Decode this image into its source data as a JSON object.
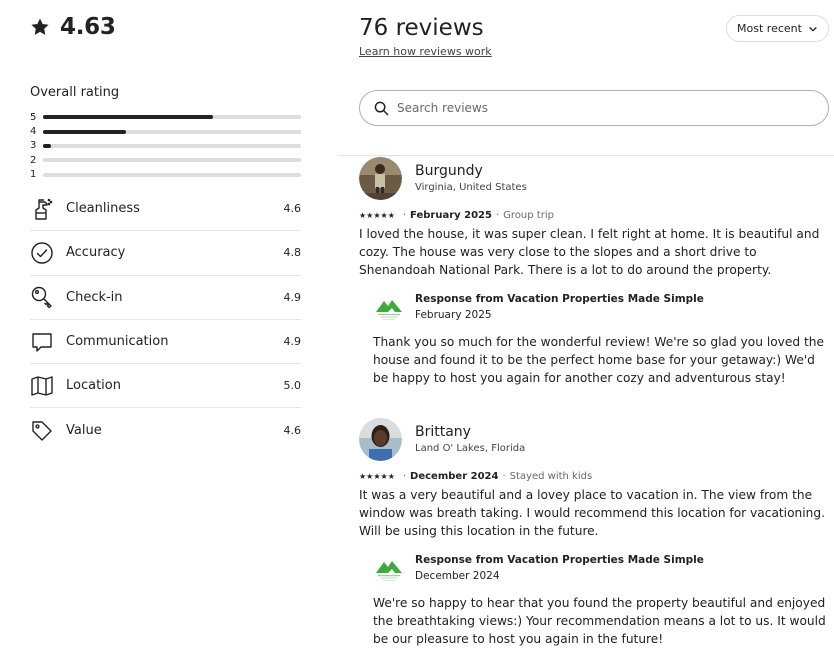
{
  "summary": {
    "average": "4.63"
  },
  "overall": {
    "title": "Overall rating",
    "bars": [
      {
        "label": "5",
        "fraction": 0.66
      },
      {
        "label": "4",
        "fraction": 0.32
      },
      {
        "label": "3",
        "fraction": 0.03
      },
      {
        "label": "2",
        "fraction": 0.0
      },
      {
        "label": "1",
        "fraction": 0.0
      }
    ]
  },
  "categories": [
    {
      "label": "Cleanliness",
      "value": "4.6",
      "icon": "spray-bottle-icon"
    },
    {
      "label": "Accuracy",
      "value": "4.8",
      "icon": "check-circle-icon"
    },
    {
      "label": "Check-in",
      "value": "4.9",
      "icon": "key-icon"
    },
    {
      "label": "Communication",
      "value": "4.9",
      "icon": "chat-bubble-icon"
    },
    {
      "label": "Location",
      "value": "5.0",
      "icon": "map-icon"
    },
    {
      "label": "Value",
      "value": "4.6",
      "icon": "price-tag-icon"
    }
  ],
  "reviews_header": {
    "title": "76 reviews",
    "learn_link": "Learn how reviews work",
    "sort_label": "Most recent"
  },
  "search": {
    "placeholder": "Search reviews"
  },
  "reviews": [
    {
      "name": "Burgundy",
      "location": "Virginia, United States",
      "stars": "★★★★★",
      "date": "February 2025",
      "trip": "Group trip",
      "text": "I loved the house, it was super clean. I felt right at home. It is beautiful and cozy. The house was very close to the slopes and a short drive to Shenandoah National Park. There is a lot to do around the property.",
      "response": {
        "title": "Response from Vacation Properties Made Simple",
        "date": "February 2025",
        "text": "Thank you so much for the wonderful review! We're so glad you loved the house and found it to be the perfect home base for your getaway:) We'd be happy to host you again for another cozy and adventurous stay!"
      }
    },
    {
      "name": "Brittany",
      "location": "Land O' Lakes, Florida",
      "stars": "★★★★★",
      "date": "December 2024",
      "trip": "Stayed with kids",
      "text": "It was a very beautiful and a lovey place to vacation in. The view from the window was breath taking. I would recommend this location for vacationing. Will be using this location in the future.",
      "response": {
        "title": "Response from Vacation Properties Made Simple",
        "date": "December 2024",
        "text": "We're so happy to hear that you found the property beautiful and enjoyed the breathtaking views:) Your recommendation means a lot to us. It would be our pleasure to host you again in the future!"
      }
    }
  ]
}
